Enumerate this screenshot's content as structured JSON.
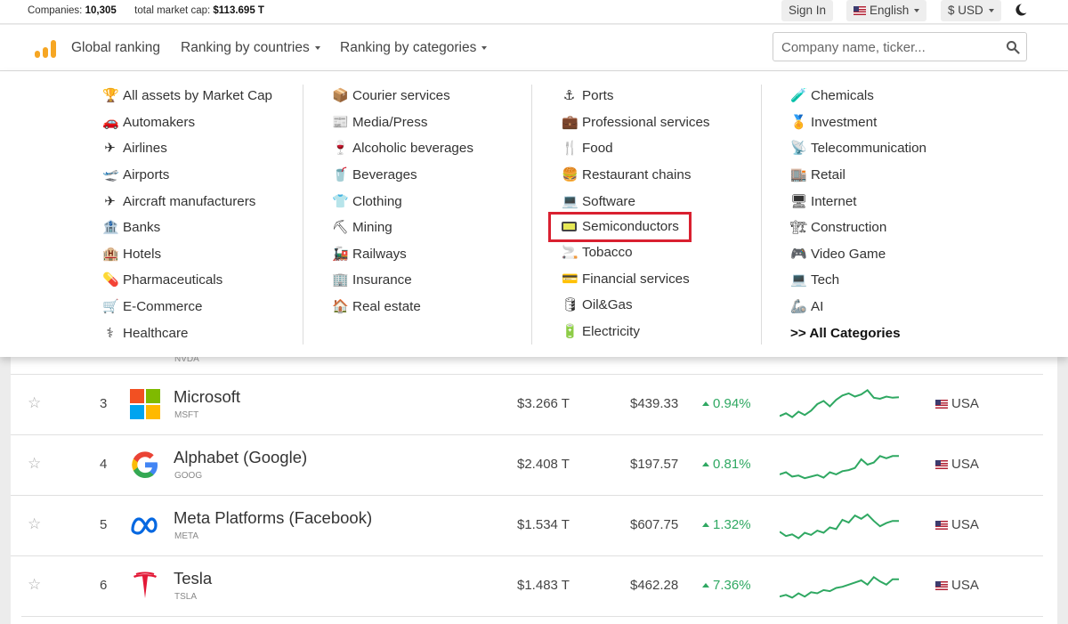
{
  "topbar": {
    "companies_label": "Companies:",
    "companies_value": "10,305",
    "marketcap_label": "total market cap:",
    "marketcap_value": "$113.695 T",
    "signin": "Sign In",
    "language": "English",
    "currency": "$ USD"
  },
  "nav": {
    "global": "Global ranking",
    "countries": "Ranking by countries",
    "categories": "Ranking by categories",
    "search_placeholder": "Company name, ticker..."
  },
  "menu": {
    "col1": [
      {
        "label": "All assets by Market Cap",
        "icon": "trophy-icon"
      },
      {
        "label": "Automakers",
        "icon": "car-icon"
      },
      {
        "label": "Airlines",
        "icon": "airplane-icon"
      },
      {
        "label": "Airports",
        "icon": "airport-icon"
      },
      {
        "label": "Aircraft manufacturers",
        "icon": "airplane-icon"
      },
      {
        "label": "Banks",
        "icon": "bank-icon"
      },
      {
        "label": "Hotels",
        "icon": "hotel-icon"
      },
      {
        "label": "Pharmaceuticals",
        "icon": "pill-icon"
      },
      {
        "label": "E-Commerce",
        "icon": "cart-icon"
      },
      {
        "label": "Healthcare",
        "icon": "healthcare-icon"
      }
    ],
    "col2": [
      {
        "label": "Courier services",
        "icon": "package-icon"
      },
      {
        "label": "Media/Press",
        "icon": "newspaper-icon"
      },
      {
        "label": "Alcoholic beverages",
        "icon": "wine-icon"
      },
      {
        "label": "Beverages",
        "icon": "cup-icon"
      },
      {
        "label": "Clothing",
        "icon": "shirt-icon"
      },
      {
        "label": "Mining",
        "icon": "pickaxe-icon"
      },
      {
        "label": "Railways",
        "icon": "train-icon"
      },
      {
        "label": "Insurance",
        "icon": "building-icon"
      },
      {
        "label": "Real estate",
        "icon": "house-icon"
      }
    ],
    "col3": [
      {
        "label": "Ports",
        "icon": "anchor-icon"
      },
      {
        "label": "Professional services",
        "icon": "briefcase-icon"
      },
      {
        "label": "Food",
        "icon": "fork-icon"
      },
      {
        "label": "Restaurant chains",
        "icon": "burger-icon"
      },
      {
        "label": "Software",
        "icon": "laptop-icon"
      },
      {
        "label": "Semiconductors",
        "icon": "chip-icon"
      },
      {
        "label": "Tobacco",
        "icon": "cigarette-icon"
      },
      {
        "label": "Financial services",
        "icon": "card-icon"
      },
      {
        "label": "Oil&Gas",
        "icon": "barrel-icon"
      },
      {
        "label": "Electricity",
        "icon": "battery-icon"
      }
    ],
    "col4": [
      {
        "label": "Chemicals",
        "icon": "test-tube-icon"
      },
      {
        "label": "Investment",
        "icon": "medal-icon"
      },
      {
        "label": "Telecommunication",
        "icon": "satellite-icon"
      },
      {
        "label": "Retail",
        "icon": "store-icon"
      },
      {
        "label": "Internet",
        "icon": "monitor-icon"
      },
      {
        "label": "Construction",
        "icon": "construction-icon"
      },
      {
        "label": "Video Game",
        "icon": "gamepad-icon"
      },
      {
        "label": "Tech",
        "icon": "laptop-icon"
      },
      {
        "label": "AI",
        "icon": "robot-arm-icon"
      },
      {
        "label": ">> All Categories",
        "icon": ""
      }
    ],
    "highlighted": "Semiconductors"
  },
  "rows": [
    {
      "rank": "3",
      "name": "Microsoft",
      "ticker": "MSFT",
      "mcap": "$3.266 T",
      "price": "$439.33",
      "change": "0.94%",
      "country": "USA",
      "spark": [
        60,
        55,
        62,
        52,
        58,
        50,
        38,
        32,
        42,
        30,
        22,
        18,
        24,
        20,
        12,
        26,
        28,
        24,
        26,
        25
      ]
    },
    {
      "rank": "4",
      "name": "Alphabet (Google)",
      "ticker": "GOOG",
      "mcap": "$2.408 T",
      "price": "$197.57",
      "change": "0.81%",
      "country": "USA",
      "spark": [
        56,
        52,
        60,
        58,
        63,
        60,
        57,
        62,
        52,
        56,
        50,
        48,
        44,
        28,
        38,
        34,
        22,
        26,
        22,
        22
      ]
    },
    {
      "rank": "5",
      "name": "Meta Platforms (Facebook)",
      "ticker": "META",
      "mcap": "$1.534 T",
      "price": "$607.75",
      "change": "1.32%",
      "country": "USA",
      "spark": [
        50,
        58,
        55,
        62,
        52,
        56,
        48,
        52,
        42,
        45,
        28,
        33,
        20,
        26,
        18,
        30,
        40,
        34,
        30,
        30
      ]
    },
    {
      "rank": "6",
      "name": "Tesla",
      "ticker": "TSLA",
      "mcap": "$1.483 T",
      "price": "$462.28",
      "change": "7.36%",
      "country": "USA",
      "spark": [
        58,
        55,
        60,
        52,
        58,
        50,
        52,
        46,
        48,
        42,
        40,
        36,
        32,
        28,
        36,
        22,
        30,
        36,
        26,
        26
      ]
    }
  ],
  "partial_row_ticker": "NVDA",
  "colors": {
    "accent_green": "#2fa862",
    "highlight_red": "#d92030",
    "logo_orange": "#f6a623"
  }
}
